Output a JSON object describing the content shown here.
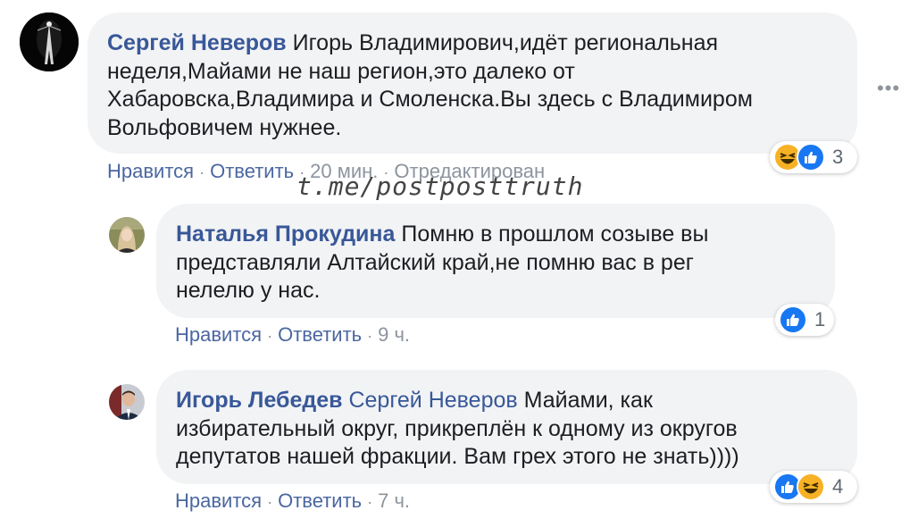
{
  "colors": {
    "link": "#385898",
    "meta": "#8d949e",
    "bubble": "#f2f3f5",
    "like": "#1877f2"
  },
  "watermark": "t.me/postposttruth",
  "more_icon": "more-horizontal-icon",
  "comments": [
    {
      "author": "Сергей Неверов",
      "mention": "",
      "text_lines": [
        "Игорь Владимирович,идёт региональная",
        "неделя,Майами не наш регион,это далеко от",
        "Хабаровска,Владимира и Смоленска.Вы здесь с Владимиром",
        "Вольфовичем нужнее."
      ],
      "actions": {
        "like": "Нравится",
        "reply": "Ответить",
        "time": "20 мин.",
        "edited": "Отредактирован"
      },
      "reactions": {
        "icons": [
          "haha-icon",
          "like-icon"
        ],
        "count": "3"
      }
    },
    {
      "author": "Наталья Прокудина",
      "mention": "",
      "text_lines": [
        "Помню в прошлом созыве вы",
        "представляли Алтайский край,не помню вас в рег",
        "нелелю у нас."
      ],
      "actions": {
        "like": "Нравится",
        "reply": "Ответить",
        "time": "9 ч."
      },
      "reactions": {
        "icons": [
          "like-icon"
        ],
        "count": "1"
      }
    },
    {
      "author": "Игорь Лебедев",
      "mention": "Сергей Неверов",
      "text_lines": [
        "Майами, как",
        "избирательный округ, прикреплён к одному из округов",
        "депутатов нашей фракции. Вам грех этого не знать))))"
      ],
      "actions": {
        "like": "Нравится",
        "reply": "Ответить",
        "time": "7 ч."
      },
      "reactions": {
        "icons": [
          "like-icon",
          "haha-icon"
        ],
        "count": "4"
      }
    }
  ]
}
